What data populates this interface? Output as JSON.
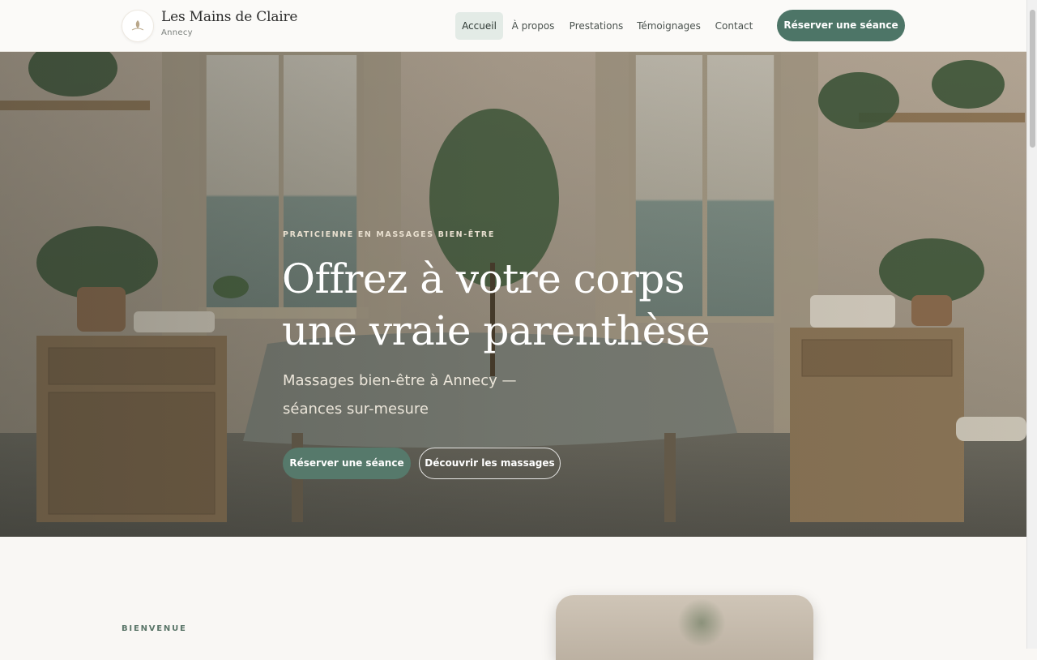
{
  "brand": {
    "name": "Les Mains de Claire",
    "city": "Annecy"
  },
  "nav": {
    "items": [
      {
        "label": "Accueil",
        "active": true
      },
      {
        "label": "À propos",
        "active": false
      },
      {
        "label": "Prestations",
        "active": false
      },
      {
        "label": "Témoignages",
        "active": false
      },
      {
        "label": "Contact",
        "active": false
      }
    ],
    "cta": "Réserver une séance"
  },
  "hero": {
    "eyebrow": "PRATICIENNE EN MASSAGES BIEN-ÊTRE",
    "title_line1": "Offrez à votre corps",
    "title_line2": "une vraie parenthèse",
    "subtitle": "Massages bien-être à Annecy — séances sur-mesure",
    "primary_button": "Réserver une séance",
    "secondary_button": "Découvrir les massages"
  },
  "intro": {
    "label": "BIENVENUE"
  },
  "colors": {
    "accent": "#4d7567",
    "background": "#f9f7f4",
    "nav_active_bg": "#e3ebe6"
  }
}
